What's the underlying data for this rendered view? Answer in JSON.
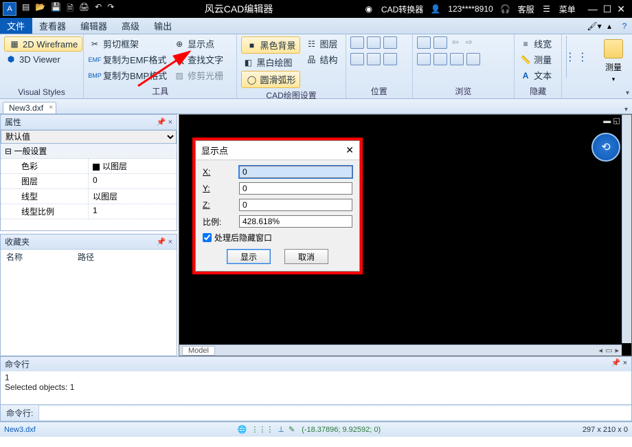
{
  "titlebar": {
    "app_title": "风云CAD编辑器",
    "convert": "CAD转换器",
    "user": "123****8910",
    "support": "客服",
    "menu": "菜单"
  },
  "menu": {
    "tabs": [
      "文件",
      "查看器",
      "编辑器",
      "高级",
      "输出"
    ]
  },
  "ribbon": {
    "visual_styles": {
      "wireframe": "2D Wireframe",
      "viewer": "3D Viewer",
      "label": "Visual Styles"
    },
    "tools": {
      "clip": "剪切框架",
      "emf": "复制为EMF格式",
      "bmp": "复制为BMP格式",
      "show_point": "显示点",
      "find_text": "查找文字",
      "trim": "修剪光栅",
      "label": "工具"
    },
    "draw_settings": {
      "black_bg": "黑色背景",
      "bw_draw": "黑白绘图",
      "arc": "圆滑弧形",
      "layers": "图层",
      "structure": "结构",
      "label": "CAD绘图设置"
    },
    "position": {
      "label": "位置"
    },
    "browse": {
      "label": "浏览"
    },
    "hide": {
      "linewidth": "线宽",
      "measure": "测量",
      "text": "文本",
      "label": "隐藏"
    },
    "measure_big": "测量"
  },
  "doc": {
    "tab": "New3.dxf"
  },
  "props": {
    "title": "属性",
    "default": "默认值",
    "section": "一般设置",
    "rows": {
      "color_k": "色彩",
      "color_v": "以图层",
      "layer_k": "图层",
      "layer_v": "0",
      "ltype_k": "线型",
      "ltype_v": "以图层",
      "lscale_k": "线型比例",
      "lscale_v": "1"
    }
  },
  "fav": {
    "title": "收藏夹",
    "name": "名称",
    "path": "路径"
  },
  "canvas": {
    "model": "Model"
  },
  "dialog": {
    "title": "显示点",
    "x_label": "X:",
    "x_value": "0",
    "y_label": "Y:",
    "y_value": "0",
    "z_label": "Z:",
    "z_value": "0",
    "scale_label": "比例:",
    "scale_value": "428.618%",
    "hide_after": "处理后隐藏窗口",
    "show_btn": "显示",
    "cancel_btn": "取消"
  },
  "cmd": {
    "title": "命令行",
    "lines": [
      "1",
      "Selected objects: 1"
    ],
    "prompt": "命令行:"
  },
  "status": {
    "file": "New3.dxf",
    "coords": "(-18.37896; 9.92592; 0)",
    "dims": "297 x 210 x 0"
  }
}
